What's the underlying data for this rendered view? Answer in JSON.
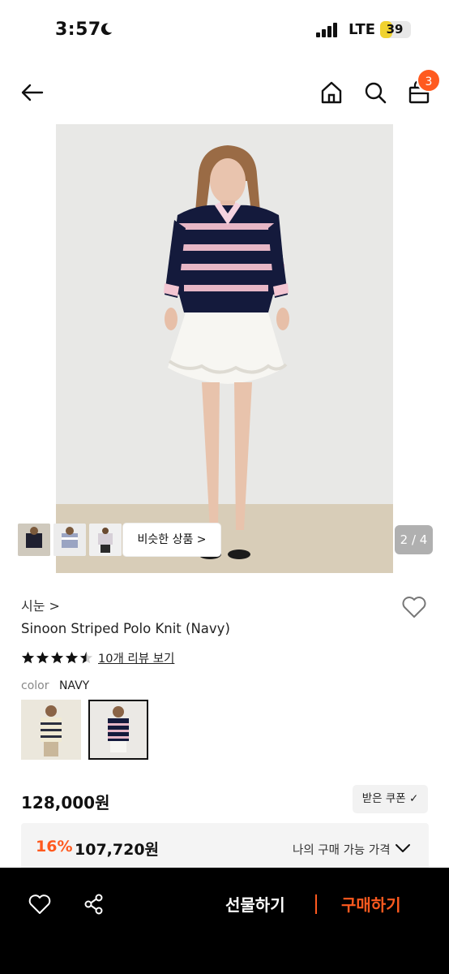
{
  "status_bar": {
    "time": "3:57",
    "network": "LTE",
    "battery": "39",
    "battery_level_percent": 39,
    "icons": [
      "moon-icon",
      "signal-icon"
    ]
  },
  "nav": {
    "icons": [
      "back-arrow-icon",
      "home-icon",
      "search-icon",
      "shopping-bag-icon"
    ],
    "cart_count": "3"
  },
  "gallery": {
    "similar_label": "비슷한 상품 >",
    "page_indicator": "2 / 4"
  },
  "product": {
    "brand": "시눈 >",
    "title": "Sinoon Striped Polo Knit (Navy)",
    "rating_stars": 4.5,
    "review_link": "10개 리뷰 보기",
    "color_label": "color",
    "color_value": "NAVY"
  },
  "price": {
    "original": "128,000원",
    "coupon_label": "받은 쿠폰 ✓",
    "discount_rate": "16%",
    "my_price": "107,720원",
    "my_price_label": "나의 구매 가능 가격"
  },
  "bottom_bar": {
    "gift_label": "선물하기",
    "buy_label": "구매하기",
    "icons": [
      "heart-icon",
      "share-icon"
    ]
  },
  "colors": {
    "accent": "#ff5a1f",
    "bottom_bar_bg": "#000000",
    "battery": "#f0d22f"
  }
}
